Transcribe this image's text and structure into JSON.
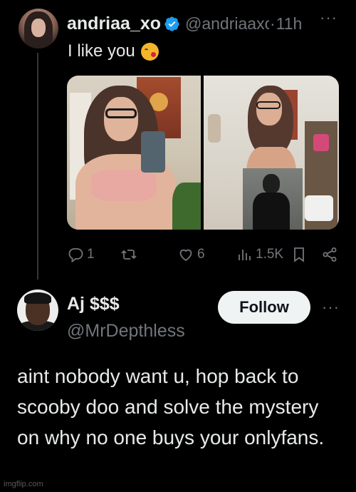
{
  "tweet1": {
    "display_name": "andriaa_xo",
    "handle": "@andriaaxo",
    "separator": "·",
    "time": "11h",
    "more_label": "···",
    "text": "I like you",
    "emoji": "kissing-face-emoji",
    "verified_color": "#1d9bf0",
    "actions": {
      "reply_count": "1",
      "retweet_count": "",
      "like_count": "6",
      "views_count": "1.5K"
    },
    "icons": [
      "reply-icon",
      "retweet-icon",
      "like-icon",
      "views-icon",
      "bookmark-icon",
      "share-icon"
    ]
  },
  "tweet2": {
    "display_name": "Aj $$$",
    "handle": "@MrDepthless",
    "follow_label": "Follow",
    "more_label": "···",
    "text": "aint nobody want u, hop back to scooby doo and solve the mystery on why no one buys your onlyfans."
  },
  "watermark": "imgflip.com",
  "colors": {
    "background": "#000000",
    "primary_text": "#e7e9ea",
    "secondary_text": "#71767b",
    "follow_bg": "#eff3f4"
  }
}
